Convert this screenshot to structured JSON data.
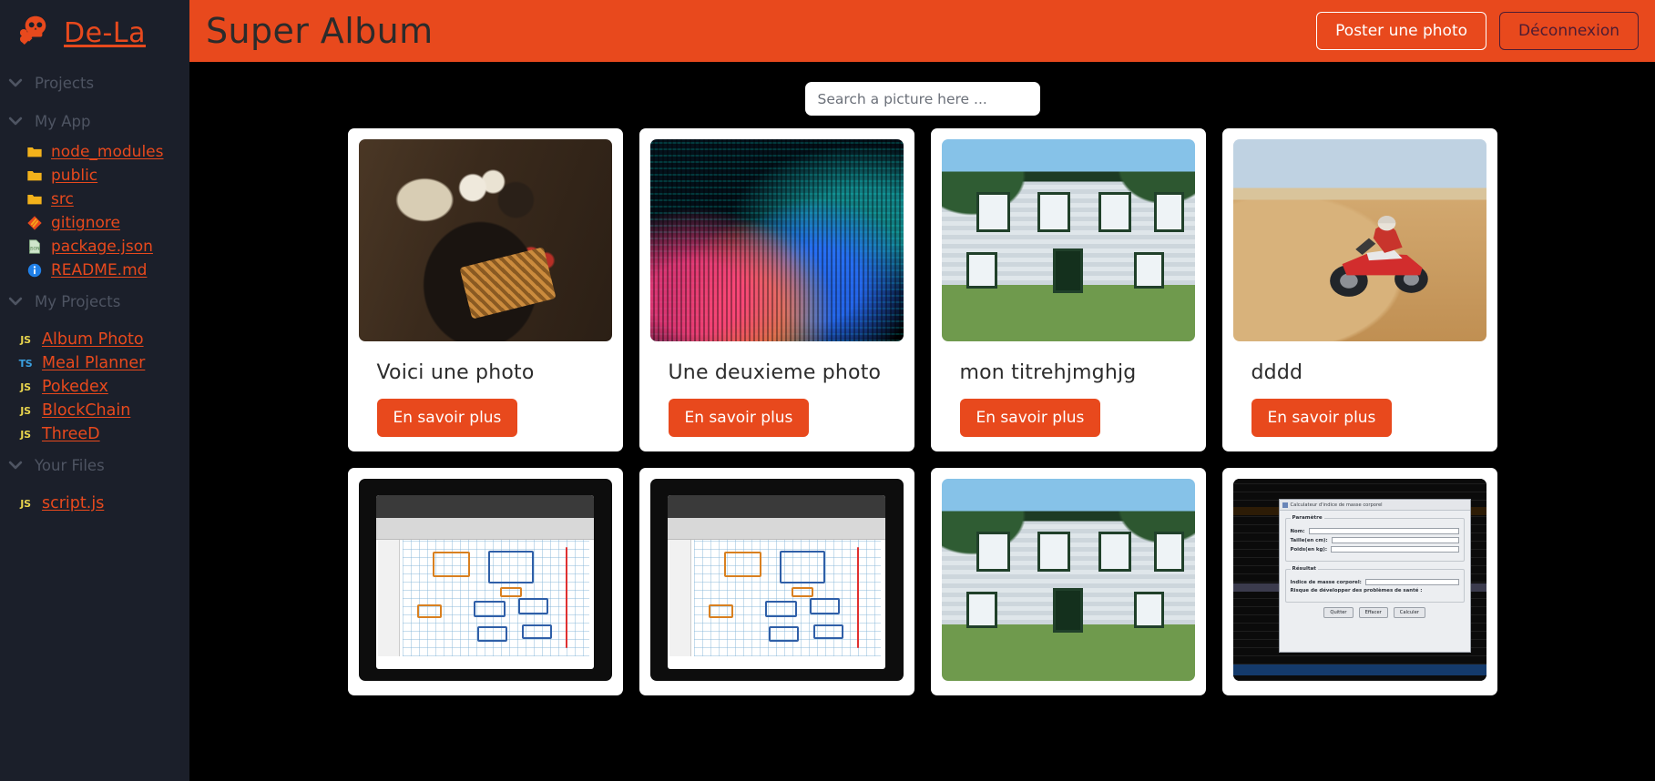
{
  "sidebar": {
    "brand": {
      "name": "De-La",
      "icon": "skull-crossbones-icon"
    },
    "sections": [
      {
        "label": "Projects",
        "icon": "chevron-down-icon",
        "items": []
      },
      {
        "label": "My App",
        "icon": "chevron-down-icon",
        "items": [
          {
            "label": "node_modules",
            "icon": "folder-icon",
            "kind": "folder"
          },
          {
            "label": "public",
            "icon": "folder-icon",
            "kind": "folder"
          },
          {
            "label": "src",
            "icon": "folder-icon",
            "kind": "folder"
          },
          {
            "label": "gitignore",
            "icon": "git-icon",
            "kind": "git"
          },
          {
            "label": "package.json",
            "icon": "json-file-icon",
            "kind": "json"
          },
          {
            "label": "README.md",
            "icon": "info-icon",
            "kind": "info"
          }
        ]
      },
      {
        "label": "My Projects",
        "icon": "chevron-down-icon",
        "items": [
          {
            "label": "Album Photo",
            "icon": "js-badge-icon",
            "kind": "js"
          },
          {
            "label": "Meal Planner",
            "icon": "ts-badge-icon",
            "kind": "ts"
          },
          {
            "label": "Pokedex",
            "icon": "js-badge-icon",
            "kind": "js"
          },
          {
            "label": "BlockChain",
            "icon": "js-badge-icon",
            "kind": "js"
          },
          {
            "label": "ThreeD",
            "icon": "js-badge-icon",
            "kind": "js"
          }
        ]
      },
      {
        "label": "Your Files",
        "icon": "chevron-down-icon",
        "items": [
          {
            "label": "script.js",
            "icon": "js-badge-icon",
            "kind": "js"
          }
        ]
      }
    ]
  },
  "header": {
    "title": "Super Album",
    "post_button": "Poster une photo",
    "logout_button": "Déconnexion"
  },
  "search": {
    "placeholder": "Search a picture here ...",
    "value": ""
  },
  "cards": [
    {
      "title": "Voici une photo",
      "button": "En savoir plus",
      "thumb": "breakfast-food-photo"
    },
    {
      "title": "Une deuxieme photo",
      "button": "En savoir plus",
      "thumb": "code-screen-photo"
    },
    {
      "title": "mon titrehjmghjg",
      "button": "En savoir plus",
      "thumb": "house-family-photo"
    },
    {
      "title": "dddd",
      "button": "En savoir plus",
      "thumb": "desert-quad-photo"
    }
  ],
  "cards_row2": [
    {
      "thumb": "tablet-whiteboard-photo"
    },
    {
      "thumb": "tablet-whiteboard-photo"
    },
    {
      "thumb": "house-family-photo"
    },
    {
      "thumb": "ide-calculator-photo"
    }
  ],
  "embedded_dialog": {
    "title": "Calculateur d'indice de masse corporel",
    "group_params": "Paramètre",
    "fields": [
      {
        "label": "Nom:",
        "value": ""
      },
      {
        "label": "Taille(en cm):",
        "value": ""
      },
      {
        "label": "Poids(en kg):",
        "value": ""
      }
    ],
    "group_result": "Résultat",
    "result_label": "Indice de masse corporel:",
    "result_value": "",
    "risk_label": "Risque de développer des problèmes de santé :",
    "buttons": [
      "Quitter",
      "Effacer",
      "Calculer"
    ]
  },
  "colors": {
    "accent": "#e8491d",
    "sidebar_bg": "#1b1f2a",
    "main_bg": "#000000",
    "card_bg": "#ffffff",
    "logout_text": "#4d1c33",
    "folder": "#f3b21b",
    "js_badge": "#e8d44d",
    "ts_badge": "#3aa0e0"
  }
}
